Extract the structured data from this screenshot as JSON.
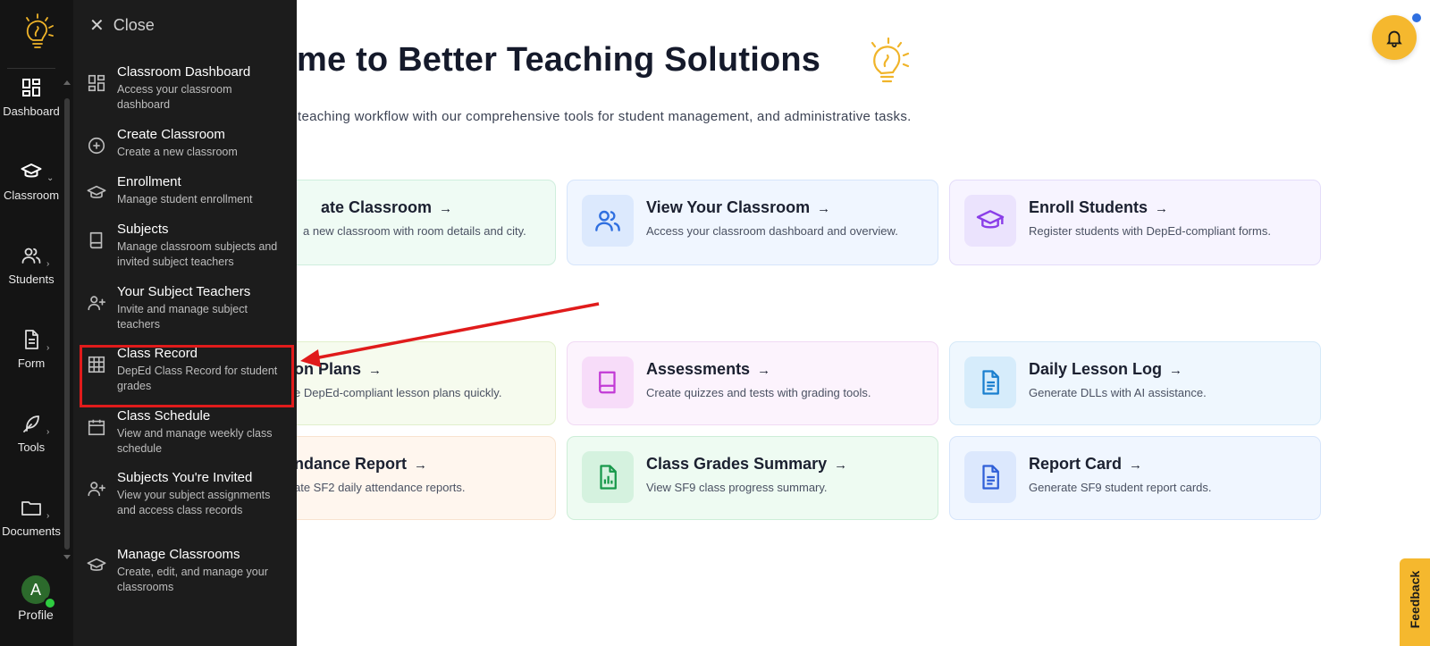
{
  "hero": {
    "title": "me to Better Teaching Solutions",
    "subtitle": "teaching workflow with our comprehensive tools for student management, and administrative tasks."
  },
  "cards": [
    {
      "title": "ate Classroom",
      "desc": "a new classroom with room details and city."
    },
    {
      "title": "View Your Classroom",
      "desc": "Access your classroom dashboard and overview."
    },
    {
      "title": "Enroll Students",
      "desc": "Register students with DepEd-compliant forms."
    },
    {
      "title": "on Plans",
      "desc": "e DepEd-compliant lesson plans quickly."
    },
    {
      "title": "Assessments",
      "desc": "Create quizzes and tests with grading tools."
    },
    {
      "title": "Daily Lesson Log",
      "desc": "Generate DLLs with AI assistance."
    },
    {
      "title": "ndance Report",
      "desc": "ate SF2 daily attendance reports."
    },
    {
      "title": "Class Grades Summary",
      "desc": "View SF9 class progress summary."
    },
    {
      "title": "Report Card",
      "desc": "Generate SF9 student report cards."
    }
  ],
  "card_arrow": "→",
  "rail": {
    "items": [
      {
        "label": "Dashboard",
        "icon": "dashboard-icon"
      },
      {
        "label": "Classroom",
        "icon": "graduation-cap-icon"
      },
      {
        "label": "Students",
        "icon": "users-icon"
      },
      {
        "label": "Form",
        "icon": "document-icon"
      },
      {
        "label": "Tools",
        "icon": "feather-icon"
      },
      {
        "label": "Documents",
        "icon": "folder-icon"
      }
    ],
    "profile_initial": "A",
    "profile_label": "Profile",
    "chevron": "›"
  },
  "flyout": {
    "close_label": "Close",
    "items": [
      {
        "title": "Classroom Dashboard",
        "desc": "Access your classroom dashboard"
      },
      {
        "title": "Create Classroom",
        "desc": "Create a new classroom"
      },
      {
        "title": "Enrollment",
        "desc": "Manage student enrollment"
      },
      {
        "title": "Subjects",
        "desc": "Manage classroom subjects and invited subject teachers"
      },
      {
        "title": "Your Subject Teachers",
        "desc": "Invite and manage subject teachers"
      },
      {
        "title": "Class Record",
        "desc": "DepEd Class Record for student grades"
      },
      {
        "title": "Class Schedule",
        "desc": "View and manage weekly class schedule"
      },
      {
        "title": "Subjects You're Invited",
        "desc": "View your subject assignments and access class records"
      },
      {
        "title": "Manage Classrooms",
        "desc": "Create, edit, and manage your classrooms"
      }
    ]
  },
  "feedback_label": "Feedback",
  "colors": {
    "accent": "#f5b82e",
    "highlight": "#e01b1b",
    "sidebar": "#141414"
  }
}
